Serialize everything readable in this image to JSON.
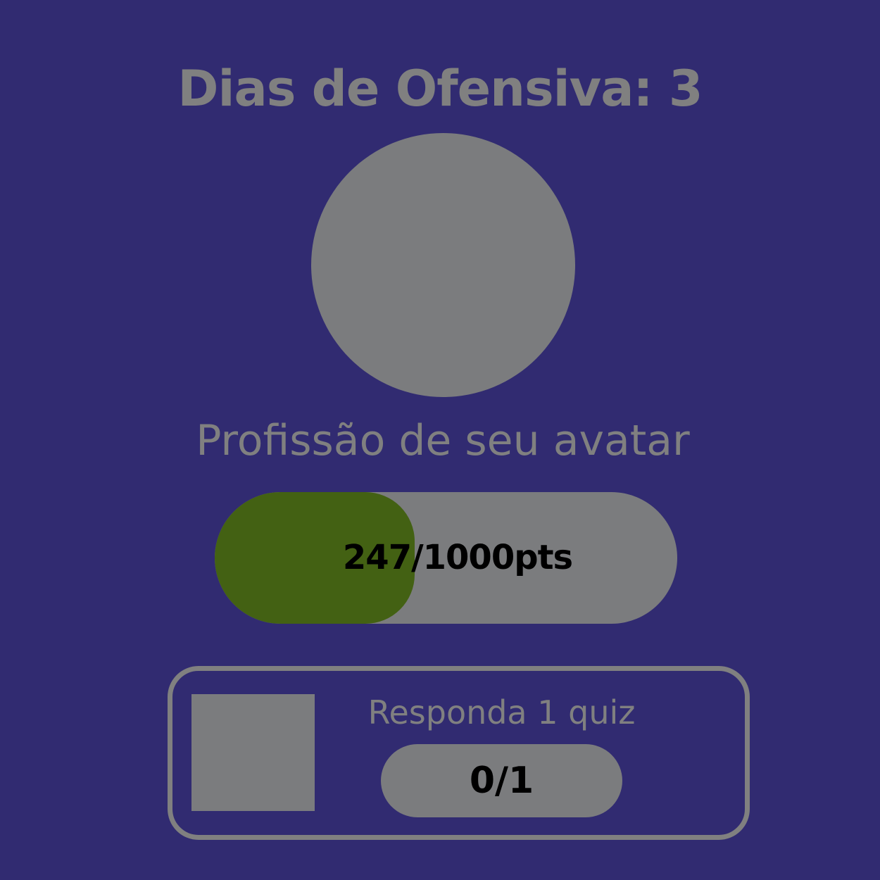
{
  "streak": {
    "label": "Dias de Ofensiva: 3"
  },
  "avatar": {
    "profession_label": "Profissão de seu avatar"
  },
  "points": {
    "current": 247,
    "max": 1000,
    "label": "247/1000pts"
  },
  "quest": {
    "title": "Responda 1 quiz",
    "progress_label": "0/1"
  },
  "colors": {
    "background": "#312b71",
    "placeholder": "#7b7c7e",
    "text_muted": "#808080",
    "progress_fill": "#436113"
  }
}
